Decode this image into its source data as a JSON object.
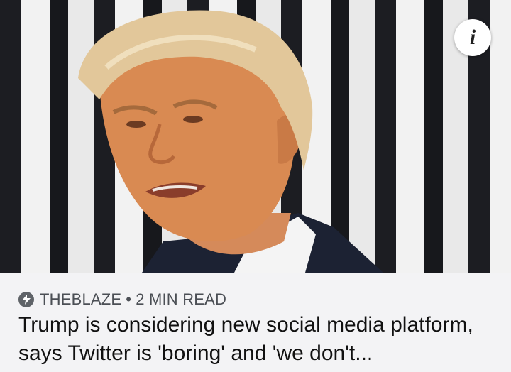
{
  "article": {
    "image_alt": "Portrait photo of Donald Trump in front of a striped border wall",
    "info_icon": "info-icon",
    "source_icon": "bolt-icon",
    "source": "THEBLAZE",
    "separator": "•",
    "read_time": "2 MIN READ",
    "headline": "Trump is considering new social media platform, says Twitter is 'boring' and 'we don't..."
  }
}
